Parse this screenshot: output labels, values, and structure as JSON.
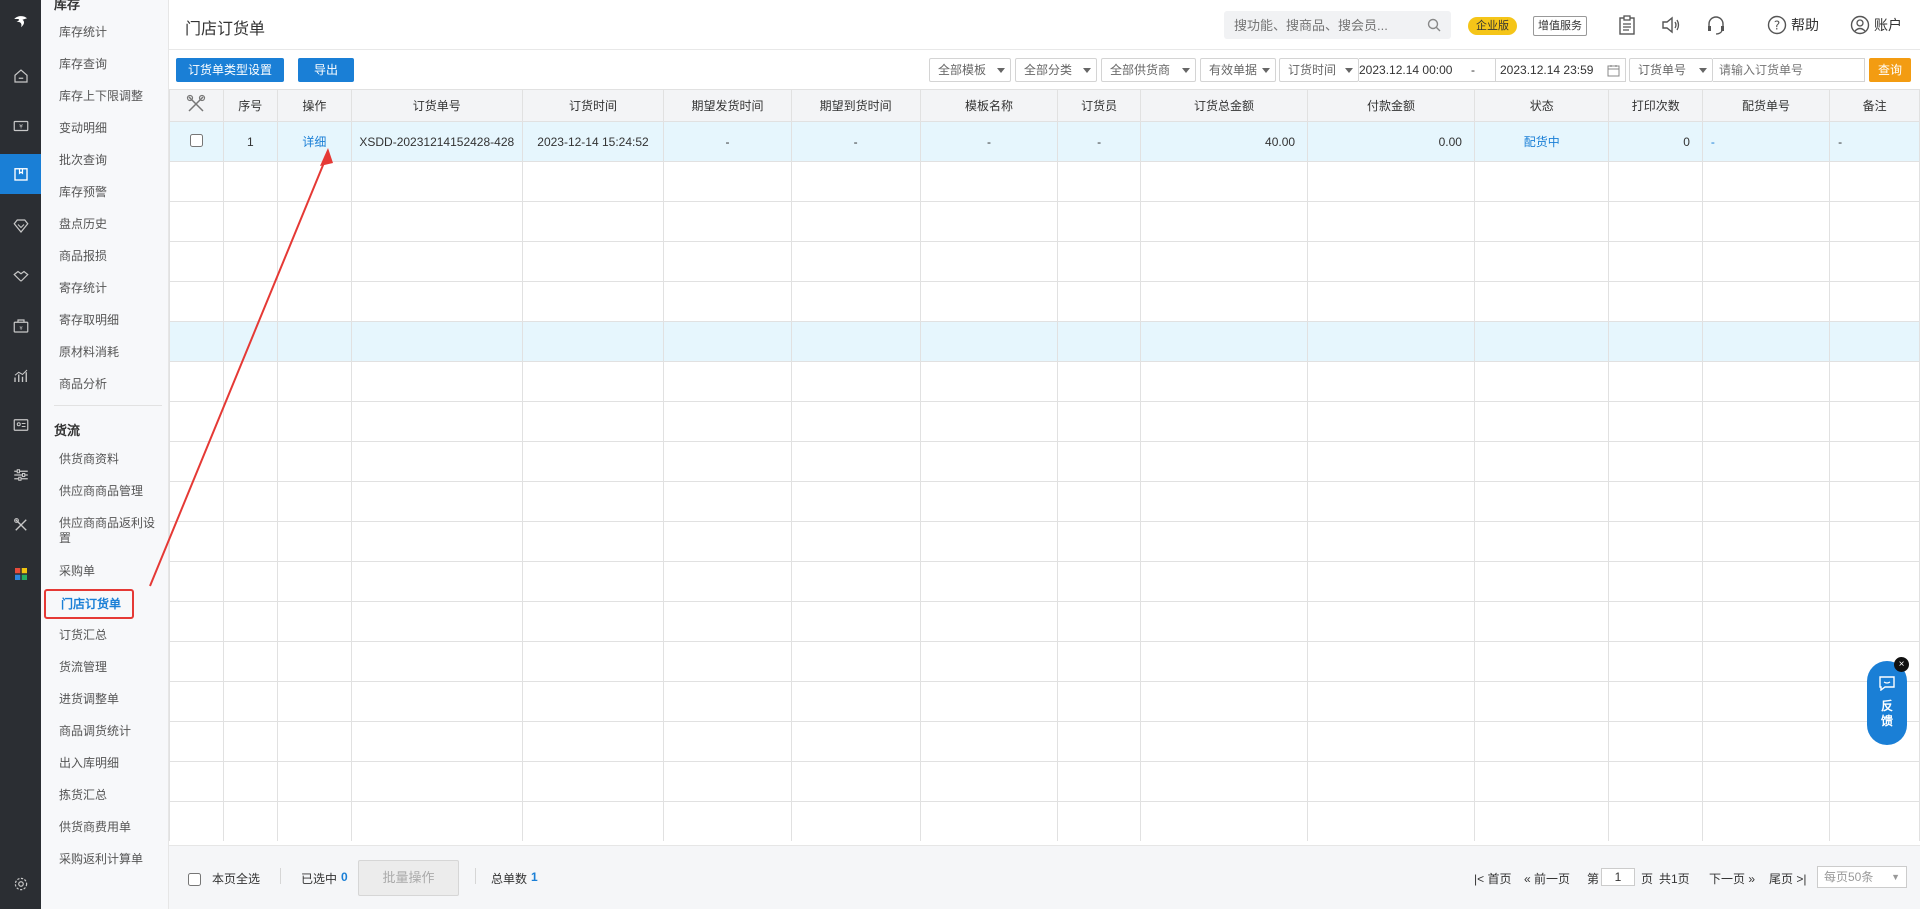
{
  "rail": {
    "items": [
      {
        "icon": "logo-icon"
      },
      {
        "icon": "home-icon"
      },
      {
        "icon": "cashier-icon"
      },
      {
        "icon": "inventory-icon",
        "active": true
      },
      {
        "icon": "diamond-icon"
      },
      {
        "icon": "handshake-icon"
      },
      {
        "icon": "wallet-icon"
      },
      {
        "icon": "chart-icon"
      },
      {
        "icon": "id-card-icon"
      },
      {
        "icon": "sliders-icon"
      },
      {
        "icon": "tools-icon"
      },
      {
        "icon": "apps-icon"
      },
      {
        "icon": "settings-icon"
      }
    ]
  },
  "submenu": {
    "group_inventory": "库存",
    "inventory_items": [
      "库存统计",
      "库存查询",
      "库存上下限调整",
      "变动明细",
      "批次查询",
      "库存预警",
      "盘点历史",
      "商品报损",
      "寄存统计",
      "寄存取明细",
      "原材料消耗",
      "商品分析"
    ],
    "group_logistics": "货流",
    "logistics_items": [
      "供货商资料",
      "供应商商品管理",
      "供应商商品返利设置",
      "采购单",
      "门店订货单",
      "订货汇总",
      "货流管理",
      "进货调整单",
      "商品调货统计",
      "出入库明细",
      "拣货汇总",
      "供货商费用单",
      "采购返利计算单"
    ],
    "active_item": "门店订货单"
  },
  "header": {
    "title": "门店订货单",
    "search_placeholder": "搜功能、搜商品、搜会员...",
    "edition_badge": "企业版",
    "value_added": "增值服务",
    "help": "帮助",
    "account": "账户"
  },
  "toolbar": {
    "type_settings": "订货单类型设置",
    "export": "导出",
    "filter_template": "全部模板",
    "filter_category": "全部分类",
    "filter_supplier": "全部供货商",
    "filter_validity": "有效单据",
    "filter_time_type": "订货时间",
    "date_start": "2023.12.14 00:00",
    "date_sep": "-",
    "date_end": "2023.12.14 23:59",
    "filter_order_field": "订货单号",
    "order_placeholder": "请输入订货单号",
    "query": "查询"
  },
  "table": {
    "columns": [
      "",
      "序号",
      "操作",
      "订货单号",
      "订货时间",
      "期望发货时间",
      "期望到货时间",
      "模板名称",
      "订货员",
      "订货总金额",
      "付款金额",
      "状态",
      "打印次数",
      "配货单号",
      "备注"
    ],
    "rows": [
      {
        "seq": "1",
        "action": "详细",
        "order_no": "XSDD-20231214152428-428",
        "order_time": "2023-12-14 15:24:52",
        "exp_ship": "-",
        "exp_arrive": "-",
        "template": "-",
        "orderer": "-",
        "total": "40.00",
        "paid": "0.00",
        "status": "配货中",
        "prints": "0",
        "dist_no": "-",
        "remark": "-"
      }
    ]
  },
  "footer": {
    "select_page": "本页全选",
    "selected_label": "已选中",
    "selected_count": "0",
    "batch": "批量操作",
    "total_label": "总单数",
    "total_count": "1",
    "first": "首页",
    "prev": "前一页",
    "page_prefix": "第",
    "page_value": "1",
    "page_suffix": "页",
    "total_pages": "共1页",
    "next": "下一页",
    "last": "尾页",
    "per_page": "每页50条"
  },
  "feedback": {
    "label": "反\n馈",
    "close": "×"
  },
  "colors": {
    "accent": "#1a7fd6",
    "highlight": "#e53935",
    "query": "#f39c12",
    "badge": "#f5c518"
  }
}
